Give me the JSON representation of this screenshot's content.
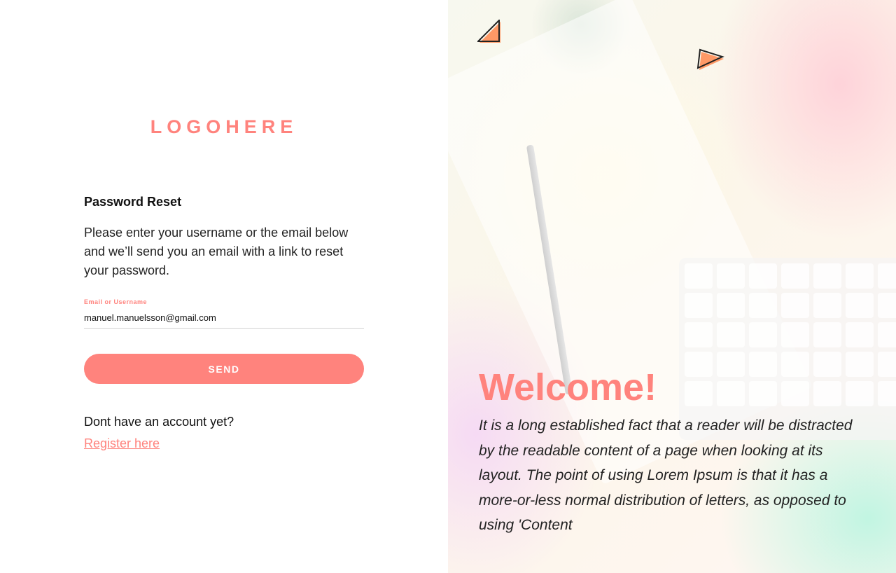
{
  "brand": {
    "logo_text": "LOGOHERE",
    "accent_color": "#ff837d"
  },
  "form": {
    "title": "Password Reset",
    "description": "Please enter your username or the email below and we’ll send you an email with a link to reset your password.",
    "field_label": "Email or Username",
    "field_value": "manuel.manuelsson@gmail.com",
    "send_label": "SEND"
  },
  "signup": {
    "prompt": "Dont have an account yet?",
    "link_label": "Register here"
  },
  "hero": {
    "title": "Welcome!",
    "text": "It is a long established fact that a reader will be distracted by the readable content of a page when looking at its layout. The point of using Lorem Ipsum is that it has a more-or-less normal distribution of letters, as opposed to using 'Content",
    "decorations": [
      "triangle-icon",
      "triangle-icon"
    ]
  }
}
